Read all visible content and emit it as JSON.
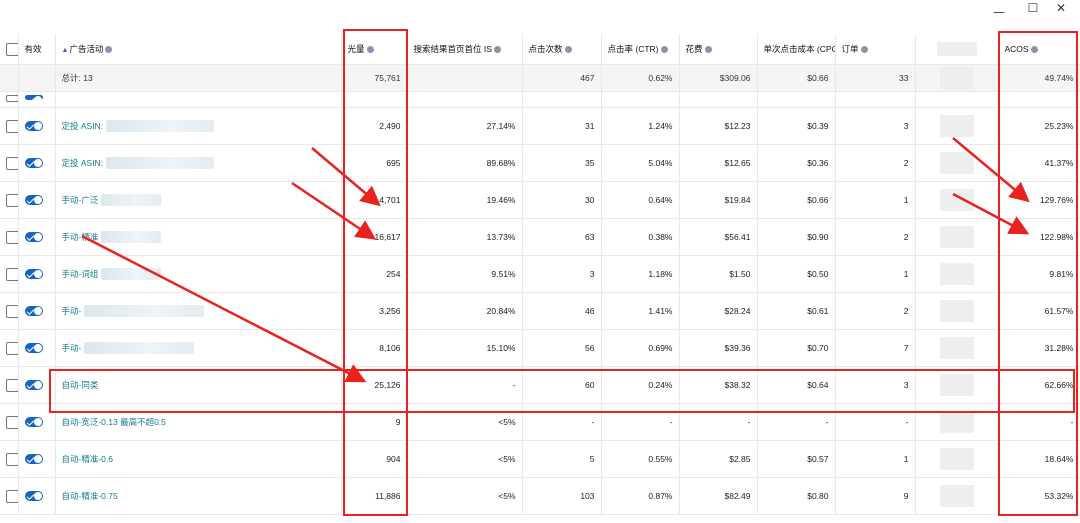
{
  "window_controls": {
    "minimize": "—",
    "maximize": "☐",
    "close": "✕"
  },
  "columns": {
    "active": "有效",
    "campaign": "广告活动",
    "impressions": "光量",
    "top_is": "搜索结果首页首位 IS",
    "clicks": "点击次数",
    "ctr": "点击率 (CTR)",
    "spend": "花费",
    "cpc": "单次点击成本 (CPC",
    "orders": "订单",
    "acos": "ACOS"
  },
  "total": {
    "label": "总计: 13",
    "impressions": "75,761",
    "clicks": "467",
    "ctr": "0.62%",
    "spend": "$309.06",
    "cpc": "$0.66",
    "orders": "33",
    "acos": "49.74%"
  },
  "rows": [
    {
      "name": "定投 ASIN:",
      "impressions": "2,490",
      "top_is": "27.14%",
      "clicks": "31",
      "ctr": "1.24%",
      "spend": "$12.23",
      "cpc": "$0.39",
      "orders": "3",
      "acos": "25.23%"
    },
    {
      "name": "定投 ASIN:",
      "impressions": "695",
      "top_is": "89.68%",
      "clicks": "35",
      "ctr": "5.04%",
      "spend": "$12.65",
      "cpc": "$0.36",
      "orders": "2",
      "acos": "41.37%"
    },
    {
      "name": "手动-广泛",
      "impressions": "4,701",
      "top_is": "19.46%",
      "clicks": "30",
      "ctr": "0.64%",
      "spend": "$19.84",
      "cpc": "$0.66",
      "orders": "1",
      "acos": "129.76%"
    },
    {
      "name": "手动-精准",
      "impressions": "16,617",
      "top_is": "13.73%",
      "clicks": "63",
      "ctr": "0.38%",
      "spend": "$56.41",
      "cpc": "$0.90",
      "orders": "2",
      "acos": "122.98%"
    },
    {
      "name": "手动-词组",
      "impressions": "254",
      "top_is": "9.51%",
      "clicks": "3",
      "ctr": "1.18%",
      "spend": "$1.50",
      "cpc": "$0.50",
      "orders": "1",
      "acos": "9.81%"
    },
    {
      "name": "手动-",
      "impressions": "3,256",
      "top_is": "20.84%",
      "clicks": "46",
      "ctr": "1.41%",
      "spend": "$28.24",
      "cpc": "$0.61",
      "orders": "2",
      "acos": "61.57%"
    },
    {
      "name": "手动-",
      "impressions": "8,106",
      "top_is": "15.10%",
      "clicks": "56",
      "ctr": "0.69%",
      "spend": "$39.36",
      "cpc": "$0.70",
      "orders": "7",
      "acos": "31.28%"
    },
    {
      "name": "自动-同类",
      "impressions": "25,126",
      "top_is": "-",
      "clicks": "60",
      "ctr": "0.24%",
      "spend": "$38.32",
      "cpc": "$0.64",
      "orders": "3",
      "acos": "62.66%"
    },
    {
      "name": "自动-宽泛-0.13 最高不超0.5",
      "impressions": "9",
      "top_is": "<5%",
      "clicks": "-",
      "ctr": "-",
      "spend": "-",
      "cpc": "-",
      "orders": "-",
      "acos": "-"
    },
    {
      "name": "自动-精准-0.6",
      "impressions": "904",
      "top_is": "<5%",
      "clicks": "5",
      "ctr": "0.55%",
      "spend": "$2.85",
      "cpc": "$0.57",
      "orders": "1",
      "acos": "18.64%"
    },
    {
      "name": "自动-精准-0.75",
      "impressions": "11,886",
      "top_is": "<5%",
      "clicks": "103",
      "ctr": "0.87%",
      "spend": "$82.49",
      "cpc": "$0.80",
      "orders": "9",
      "acos": "53.32%"
    }
  ],
  "annotation_color": "#e8231f"
}
